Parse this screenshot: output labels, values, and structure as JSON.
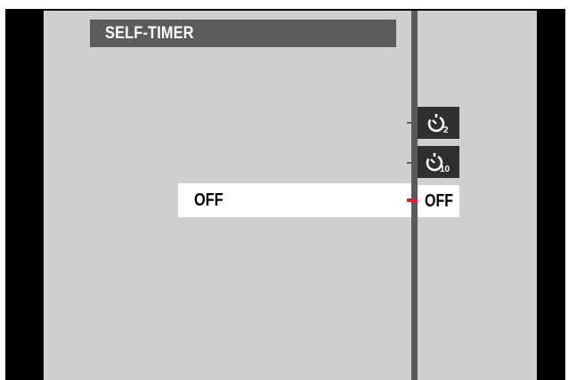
{
  "menu": {
    "title": "SELF-TIMER",
    "selected_option_label": "OFF"
  },
  "dial": {
    "items": [
      {
        "icon": "self-timer-2s-icon",
        "label": ""
      },
      {
        "icon": "self-timer-10s-icon",
        "label": ""
      },
      {
        "icon": "",
        "label": "OFF"
      }
    ],
    "selected_index": 2
  },
  "colors": {
    "background": "#cfcfcf",
    "title_bar": "#5c5c5c",
    "dial_item": "#2f2f2f",
    "indicator": "#e01b24"
  }
}
